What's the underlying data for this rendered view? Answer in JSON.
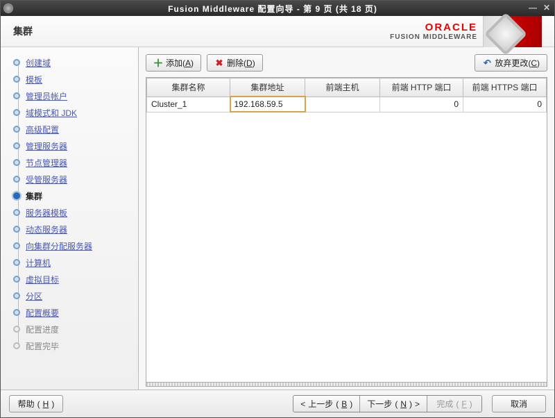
{
  "window": {
    "title": "Fusion Middleware 配置向导 - 第 9 页 (共 18 页)"
  },
  "header": {
    "page_title": "集群",
    "brand": "ORACLE",
    "brand_sub": "FUSION MIDDLEWARE"
  },
  "nav": {
    "items": [
      {
        "label": "创建域",
        "state": "done"
      },
      {
        "label": "模板",
        "state": "done"
      },
      {
        "label": "管理员帐户",
        "state": "done"
      },
      {
        "label": "域模式和 JDK",
        "state": "done"
      },
      {
        "label": "高级配置",
        "state": "done"
      },
      {
        "label": "管理服务器",
        "state": "done"
      },
      {
        "label": "节点管理器",
        "state": "done"
      },
      {
        "label": "受管服务器",
        "state": "done"
      },
      {
        "label": "集群",
        "state": "current"
      },
      {
        "label": "服务器模板",
        "state": "done"
      },
      {
        "label": "动态服务器",
        "state": "done"
      },
      {
        "label": "向集群分配服务器",
        "state": "done"
      },
      {
        "label": "计算机",
        "state": "done"
      },
      {
        "label": "虚拟目标",
        "state": "done"
      },
      {
        "label": "分区",
        "state": "done"
      },
      {
        "label": "配置概要",
        "state": "done"
      },
      {
        "label": "配置进度",
        "state": "future"
      },
      {
        "label": "配置完毕",
        "state": "future"
      }
    ]
  },
  "toolbar": {
    "add": {
      "label": "添加",
      "key": "A",
      "letter": "(A)"
    },
    "delete": {
      "label": "删除",
      "key": "D",
      "letter": "(D)"
    },
    "discard": {
      "label": "放弃更改",
      "key": "C",
      "letter": "(C)"
    }
  },
  "table": {
    "headers": [
      "集群名称",
      "集群地址",
      "前端主机",
      "前端 HTTP 端口",
      "前端 HTTPS 端口"
    ],
    "rows": [
      {
        "name": "Cluster_1",
        "address": "192.168.59.5",
        "frontend_host": "",
        "http_port": "0",
        "https_port": "0",
        "active_col": 1
      }
    ]
  },
  "footer": {
    "help": {
      "label": "帮助",
      "key": "H"
    },
    "back": {
      "label": "上一步",
      "key": "B",
      "prefix": "< "
    },
    "next": {
      "label": "下一步",
      "key": "N",
      "suffix": " >"
    },
    "finish": {
      "label": "完成",
      "key": "F"
    },
    "cancel": {
      "label": "取消"
    }
  }
}
